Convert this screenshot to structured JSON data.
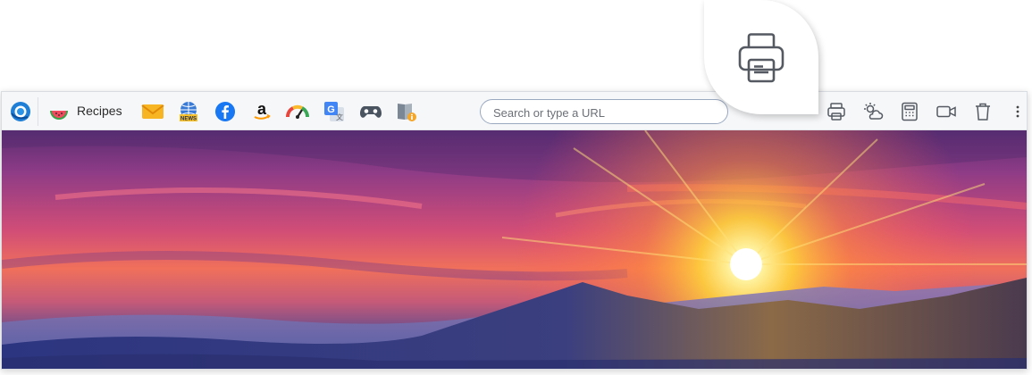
{
  "toolbar": {
    "bookmarks": [
      {
        "name": "browser-logo-icon"
      },
      {
        "name": "watermelon-icon",
        "label": "Recipes"
      },
      {
        "name": "mail-icon"
      },
      {
        "name": "news-icon",
        "badge": "NEWS"
      },
      {
        "name": "facebook-icon"
      },
      {
        "name": "amazon-icon"
      },
      {
        "name": "speedometer-icon"
      },
      {
        "name": "translate-icon"
      },
      {
        "name": "gamepad-icon"
      },
      {
        "name": "book-info-icon"
      }
    ],
    "search": {
      "placeholder": "Search or type a URL",
      "value": ""
    },
    "right_icons": [
      "printer-icon",
      "weather-icon",
      "calculator-icon",
      "video-camera-icon",
      "trash-icon",
      "more-menu-icon"
    ]
  },
  "callout": {
    "icon": "printer-icon"
  },
  "colors": {
    "accent_blue": "#1877f2",
    "toolbar_bg": "#f6f7f9",
    "icon_grey": "#555a62"
  }
}
